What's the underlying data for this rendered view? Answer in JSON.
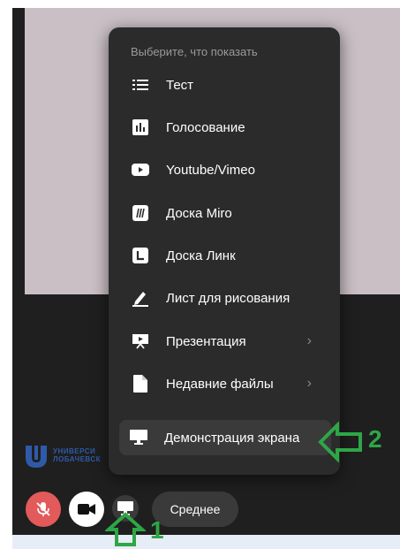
{
  "menu": {
    "title": "Выберите, что показать",
    "items": [
      {
        "label": "Тест",
        "icon": "list-icon"
      },
      {
        "label": "Голосование",
        "icon": "poll-icon"
      },
      {
        "label": "Youtube/Vimeo",
        "icon": "youtube-icon"
      },
      {
        "label": "Доска Miro",
        "icon": "miro-icon"
      },
      {
        "label": "Доска Линк",
        "icon": "link-board-icon"
      },
      {
        "label": "Лист для рисования",
        "icon": "pencil-icon"
      },
      {
        "label": "Презентация",
        "icon": "presentation-icon",
        "submenu": true
      },
      {
        "label": "Недавние файлы",
        "icon": "file-icon",
        "submenu": true
      },
      {
        "label": "Демонстрация экрана",
        "icon": "monitor-icon",
        "active": true
      }
    ]
  },
  "controls": {
    "quality_label": "Среднее"
  },
  "logo": {
    "line1": "УНИВЕРСИ",
    "line2": "ЛОБАЧЕВСК"
  },
  "annotations": {
    "arrow1_number": "1",
    "arrow2_number": "2"
  },
  "colors": {
    "accent_green": "#2ea646",
    "mic_red": "#e35a5a",
    "menu_bg": "#2b2b2b"
  }
}
